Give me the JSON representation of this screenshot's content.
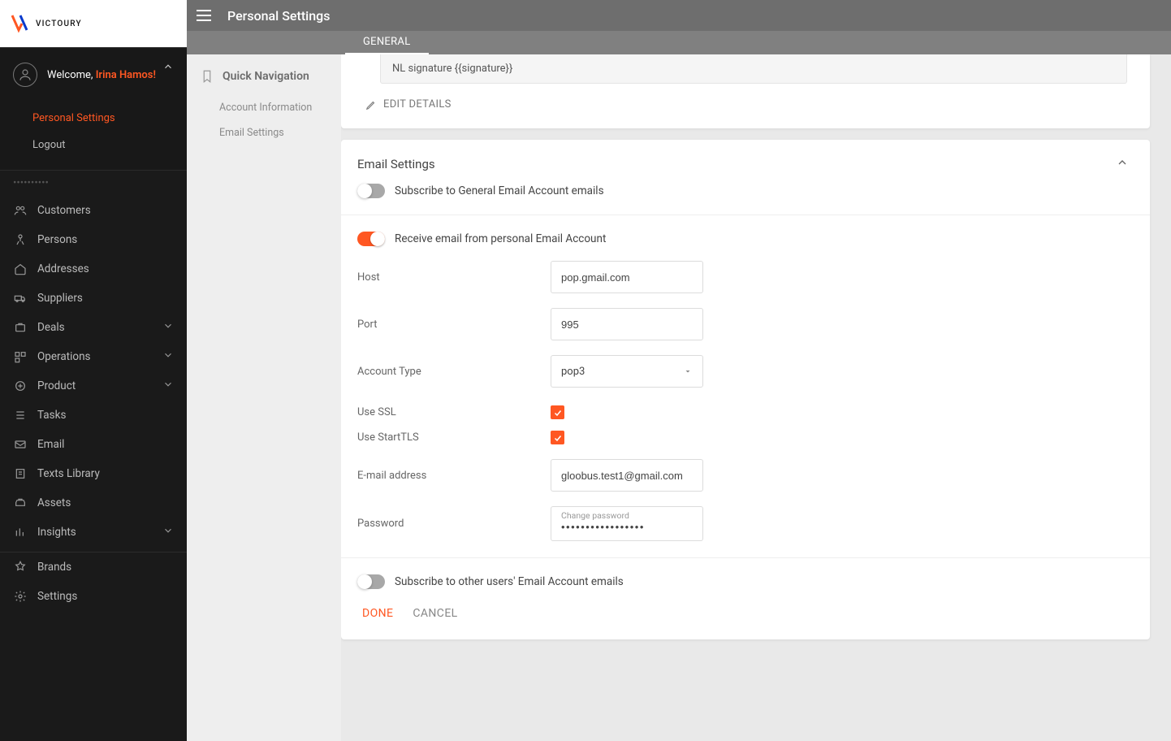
{
  "brand": {
    "name": "VICTOURY"
  },
  "user": {
    "welcome_prefix": "Welcome, ",
    "name": "Irina Hamos!"
  },
  "user_menu": {
    "items": [
      {
        "label": "Personal Settings",
        "active": true
      },
      {
        "label": "Logout",
        "active": false
      }
    ]
  },
  "sidebar_nav": [
    {
      "label": "Customers",
      "icon": "customers",
      "expandable": false
    },
    {
      "label": "Persons",
      "icon": "persons",
      "expandable": false
    },
    {
      "label": "Addresses",
      "icon": "addresses",
      "expandable": false
    },
    {
      "label": "Suppliers",
      "icon": "suppliers",
      "expandable": false
    },
    {
      "label": "Deals",
      "icon": "deals",
      "expandable": true
    },
    {
      "label": "Operations",
      "icon": "operations",
      "expandable": true
    },
    {
      "label": "Product",
      "icon": "product",
      "expandable": true
    },
    {
      "label": "Tasks",
      "icon": "tasks",
      "expandable": false
    },
    {
      "label": "Email",
      "icon": "email",
      "expandable": false
    },
    {
      "label": "Texts Library",
      "icon": "texts",
      "expandable": false
    },
    {
      "label": "Assets",
      "icon": "assets",
      "expandable": false
    },
    {
      "label": "Insights",
      "icon": "insights",
      "expandable": true
    }
  ],
  "sidebar_footer": [
    {
      "label": "Brands",
      "icon": "brands"
    },
    {
      "label": "Settings",
      "icon": "settings"
    }
  ],
  "page": {
    "title": "Personal Settings"
  },
  "tabs": {
    "general": "GENERAL"
  },
  "quicknav": {
    "title": "Quick Navigation",
    "items": [
      {
        "label": "Account Information"
      },
      {
        "label": "Email Settings"
      }
    ]
  },
  "signature_preview": "NL signature {{signature}}",
  "edit_details_label": "EDIT DETAILS",
  "email_settings": {
    "title": "Email Settings",
    "subscribe_general_label": "Subscribe to General Email Account emails",
    "subscribe_general_on": false,
    "receive_personal_label": "Receive email from personal Email Account",
    "receive_personal_on": true,
    "fields": {
      "host": {
        "label": "Host",
        "value": "pop.gmail.com"
      },
      "port": {
        "label": "Port",
        "value": "995"
      },
      "account_type": {
        "label": "Account Type",
        "value": "pop3"
      },
      "use_ssl": {
        "label": "Use SSL",
        "checked": true
      },
      "use_starttls": {
        "label": "Use StartTLS",
        "checked": true
      },
      "email": {
        "label": "E-mail address",
        "value": "gloobus.test1@gmail.com"
      },
      "password": {
        "label": "Password",
        "float_label": "Change password",
        "value": "•••••••••••••••••"
      }
    },
    "subscribe_other_label": "Subscribe to other users' Email Account emails",
    "subscribe_other_on": false,
    "done_label": "DONE",
    "cancel_label": "CANCEL"
  }
}
